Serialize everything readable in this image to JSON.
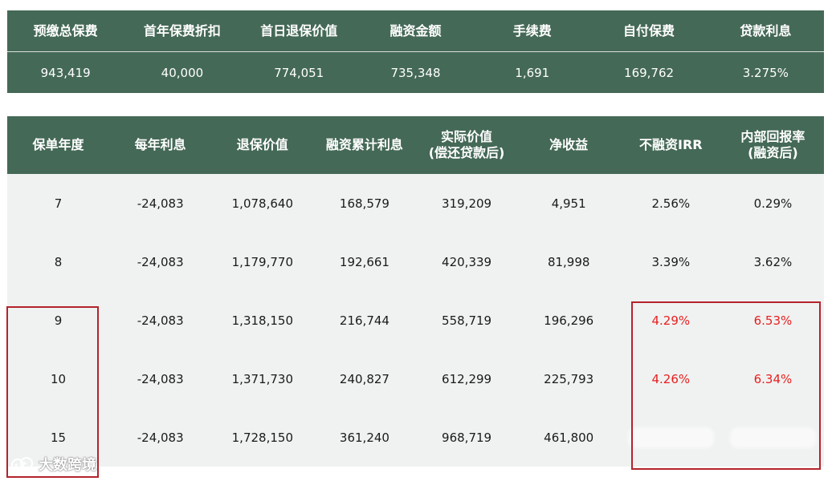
{
  "summary": {
    "headers": [
      "预缴总保费",
      "首年保费折扣",
      "首日退保价值",
      "融资金额",
      "手续费",
      "自付保费",
      "贷款利息"
    ],
    "values": [
      "943,419",
      "40,000",
      "774,051",
      "735,348",
      "1,691",
      "169,762",
      "3.275%"
    ]
  },
  "main_table": {
    "headers": [
      {
        "line1": "保单年度",
        "line2": ""
      },
      {
        "line1": "每年利息",
        "line2": ""
      },
      {
        "line1": "退保价值",
        "line2": ""
      },
      {
        "line1": "融资累计利息",
        "line2": ""
      },
      {
        "line1": "实际价值",
        "line2": "(偿还贷款后)"
      },
      {
        "line1": "净收益",
        "line2": ""
      },
      {
        "line1": "不融资IRR",
        "line2": ""
      },
      {
        "line1": "内部回报率",
        "line2": "(融资后)"
      }
    ],
    "rows": [
      [
        "7",
        "-24,083",
        "1,078,640",
        "168,579",
        "319,209",
        "4,951",
        "2.56%",
        "0.29%"
      ],
      [
        "8",
        "-24,083",
        "1,179,770",
        "192,661",
        "420,339",
        "81,998",
        "3.39%",
        "3.62%"
      ],
      [
        "9",
        "-24,083",
        "1,318,150",
        "216,744",
        "558,719",
        "196,296",
        "4.29%",
        "6.53%"
      ],
      [
        "10",
        "-24,083",
        "1,371,730",
        "240,827",
        "612,299",
        "225,793",
        "4.26%",
        "6.34%"
      ],
      [
        "15",
        "-24,083",
        "1,728,150",
        "361,240",
        "968,719",
        "461,800",
        "",
        ""
      ]
    ]
  },
  "watermark": {
    "text": "大数跨境",
    "icon": "panda-logo-icon"
  },
  "colors": {
    "header_bg": "#456957",
    "row_bg": "#f0f2f1",
    "highlight_border": "#b4232b",
    "highlight_text": "#e62020"
  }
}
